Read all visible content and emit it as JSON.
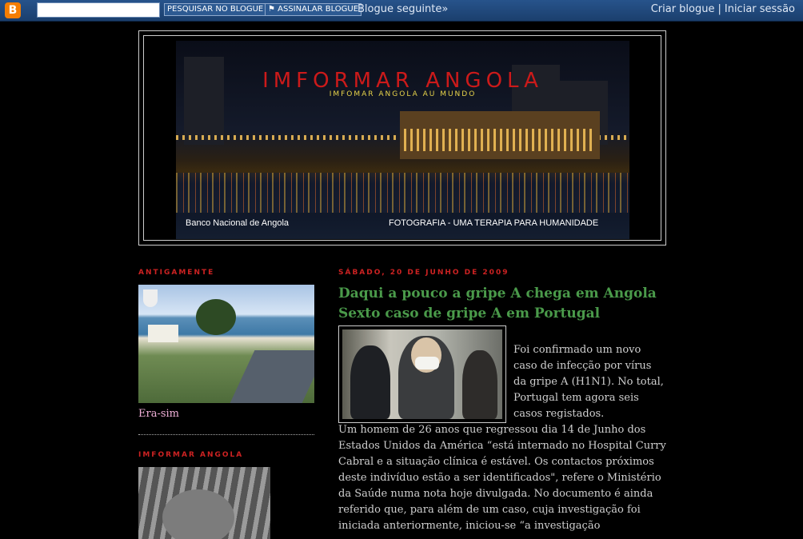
{
  "navbar": {
    "logo": "B",
    "search_placeholder": "",
    "search_button": "PESQUISAR NO BLOGUE",
    "follow_button": "⚑ ASSINALAR BLOGUE",
    "next_blog": "Blogue seguinte»",
    "create_blog": "Criar blogue",
    "separator": "|",
    "sign_in": "Iniciar sessão"
  },
  "header": {
    "title": "IMFORMAR ANGOLA",
    "description": "IMFOMAR ANGOLA AU MUNDO",
    "caption_left": "Banco Nacional de Angola",
    "caption_right": "FOTOGRAFIA - UMA TERAPIA PARA HUMANIDADE"
  },
  "sidebar": {
    "widgets": [
      {
        "title": "ANTIGAMENTE",
        "caption": "Era-sim"
      },
      {
        "title": "IMFORMAR ANGOLA"
      }
    ]
  },
  "post": {
    "date": "SÁBADO, 20 DE JUNHO DE 2009",
    "title": "Daqui a pouco a gripe A chega em Angola Sexto caso de gripe A em Portugal",
    "body_side": "Foi confirmado um novo caso de infecção por vírus da gripe A (H1N1). No total, Portugal tem agora seis casos registados.",
    "body_full": "Um homem de 26 anos que regressou dia 14 de Junho dos Estados Unidos da América “está internado no Hospital Curry Cabral e a situação clínica é estável. Os contactos próximos deste indivíduo estão a ser identificados\", refere o Ministério da Saúde numa nota hoje divulgada. No documento é ainda referido que, para além de um caso, cuja investigação foi iniciada anteriormente, iniciou-se “a investigação"
  },
  "colors": {
    "navbar": "#1b3f6d",
    "title_red": "#cc1a1a",
    "post_title_green": "#4a9a4a",
    "widget_title_red": "#cc2222",
    "caption_pink": "#f0b0d8"
  }
}
